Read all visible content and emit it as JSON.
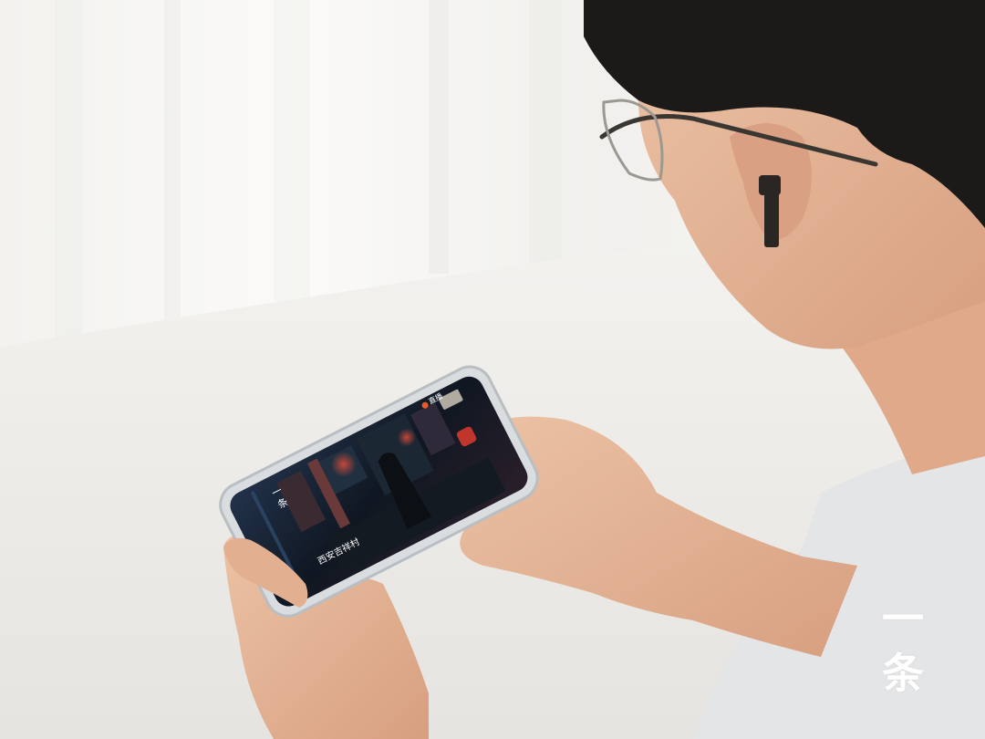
{
  "watermark": {
    "line1": "一",
    "line2": "条"
  },
  "phone_screen": {
    "logo_line1": "一",
    "logo_line2": "条",
    "caption": "西安吉祥村",
    "live_label": "直播"
  },
  "colors": {
    "background": "#ecebe8",
    "curtain": "#f6f5f3",
    "table": "#efedea",
    "skin": "#e3b393",
    "hair": "#1c1a18",
    "earbud": "#2a2623",
    "shirt": "#e4e5e7",
    "phone_case": "#d9dde0",
    "phone_screen": "#101722",
    "neon_accent": "#c0352c"
  },
  "icons": [
    "earbud-icon",
    "glasses-icon",
    "phone-icon"
  ]
}
